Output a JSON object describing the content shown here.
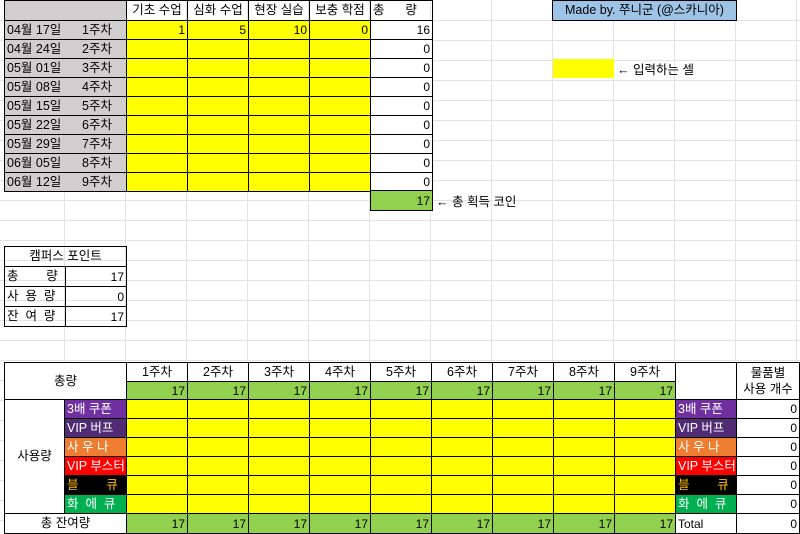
{
  "header": {
    "columns": [
      "기초 수업",
      "심화 수업",
      "현장 실습",
      "보충 학점",
      "총      량"
    ]
  },
  "credit": "Made by. 쭈니군 (@스카니아)",
  "legend": {
    "input_label": "← 입력하는 셀"
  },
  "weeks": [
    {
      "date": "04월 17일",
      "week": "1주차",
      "vals": [
        "1",
        "5",
        "10",
        "0"
      ],
      "total": "16"
    },
    {
      "date": "04월 24일",
      "week": "2주차",
      "vals": [
        "",
        "",
        "",
        ""
      ],
      "total": "0"
    },
    {
      "date": "05월 01일",
      "week": "3주차",
      "vals": [
        "",
        "",
        "",
        ""
      ],
      "total": "0"
    },
    {
      "date": "05월 08일",
      "week": "4주차",
      "vals": [
        "",
        "",
        "",
        ""
      ],
      "total": "0"
    },
    {
      "date": "05월 15일",
      "week": "5주차",
      "vals": [
        "",
        "",
        "",
        ""
      ],
      "total": "0"
    },
    {
      "date": "05월 22일",
      "week": "6주차",
      "vals": [
        "",
        "",
        "",
        ""
      ],
      "total": "0"
    },
    {
      "date": "05월 29일",
      "week": "7주차",
      "vals": [
        "",
        "",
        "",
        ""
      ],
      "total": "0"
    },
    {
      "date": "06월 05일",
      "week": "8주차",
      "vals": [
        "",
        "",
        "",
        ""
      ],
      "total": "0"
    },
    {
      "date": "06월 12일",
      "week": "9주차",
      "vals": [
        "",
        "",
        "",
        ""
      ],
      "total": "0"
    }
  ],
  "coins": {
    "value": "17",
    "label": "← 총 획득 코인"
  },
  "points": {
    "title": "캠퍼스 포인트",
    "rows": [
      {
        "label": "총        량",
        "value": "17"
      },
      {
        "label": "사  용  량",
        "value": "0"
      },
      {
        "label": "잔  여  량",
        "value": "17"
      }
    ]
  },
  "usage": {
    "total_label": "총량",
    "week_labels": [
      "1주차",
      "2주차",
      "3주차",
      "4주차",
      "5주차",
      "6주차",
      "7주차",
      "8주차",
      "9주차"
    ],
    "totals": [
      "17",
      "17",
      "17",
      "17",
      "17",
      "17",
      "17",
      "17",
      "17"
    ],
    "usage_label": "사용량",
    "item_header": [
      "물품별",
      "사용 개수"
    ],
    "items": [
      {
        "name": "3배 쿠폰",
        "count": "0"
      },
      {
        "name": "VIP 버프",
        "count": "0"
      },
      {
        "name": "사 우 나",
        "count": "0"
      },
      {
        "name": "VIP 부스터",
        "count": "0"
      },
      {
        "name": "블        큐",
        "count": "0"
      },
      {
        "name": "화  에  큐",
        "count": "0"
      }
    ],
    "remaining_label": "총 잔여량",
    "remaining": [
      "17",
      "17",
      "17",
      "17",
      "17",
      "17",
      "17",
      "17",
      "17"
    ],
    "grand_total_label": "Total",
    "grand_total": "0"
  },
  "colors": {
    "input_yellow": "#ffff00",
    "total_green": "#92d050",
    "label_gray": "#d0cece",
    "credit_blue": "#9dc3e6"
  }
}
